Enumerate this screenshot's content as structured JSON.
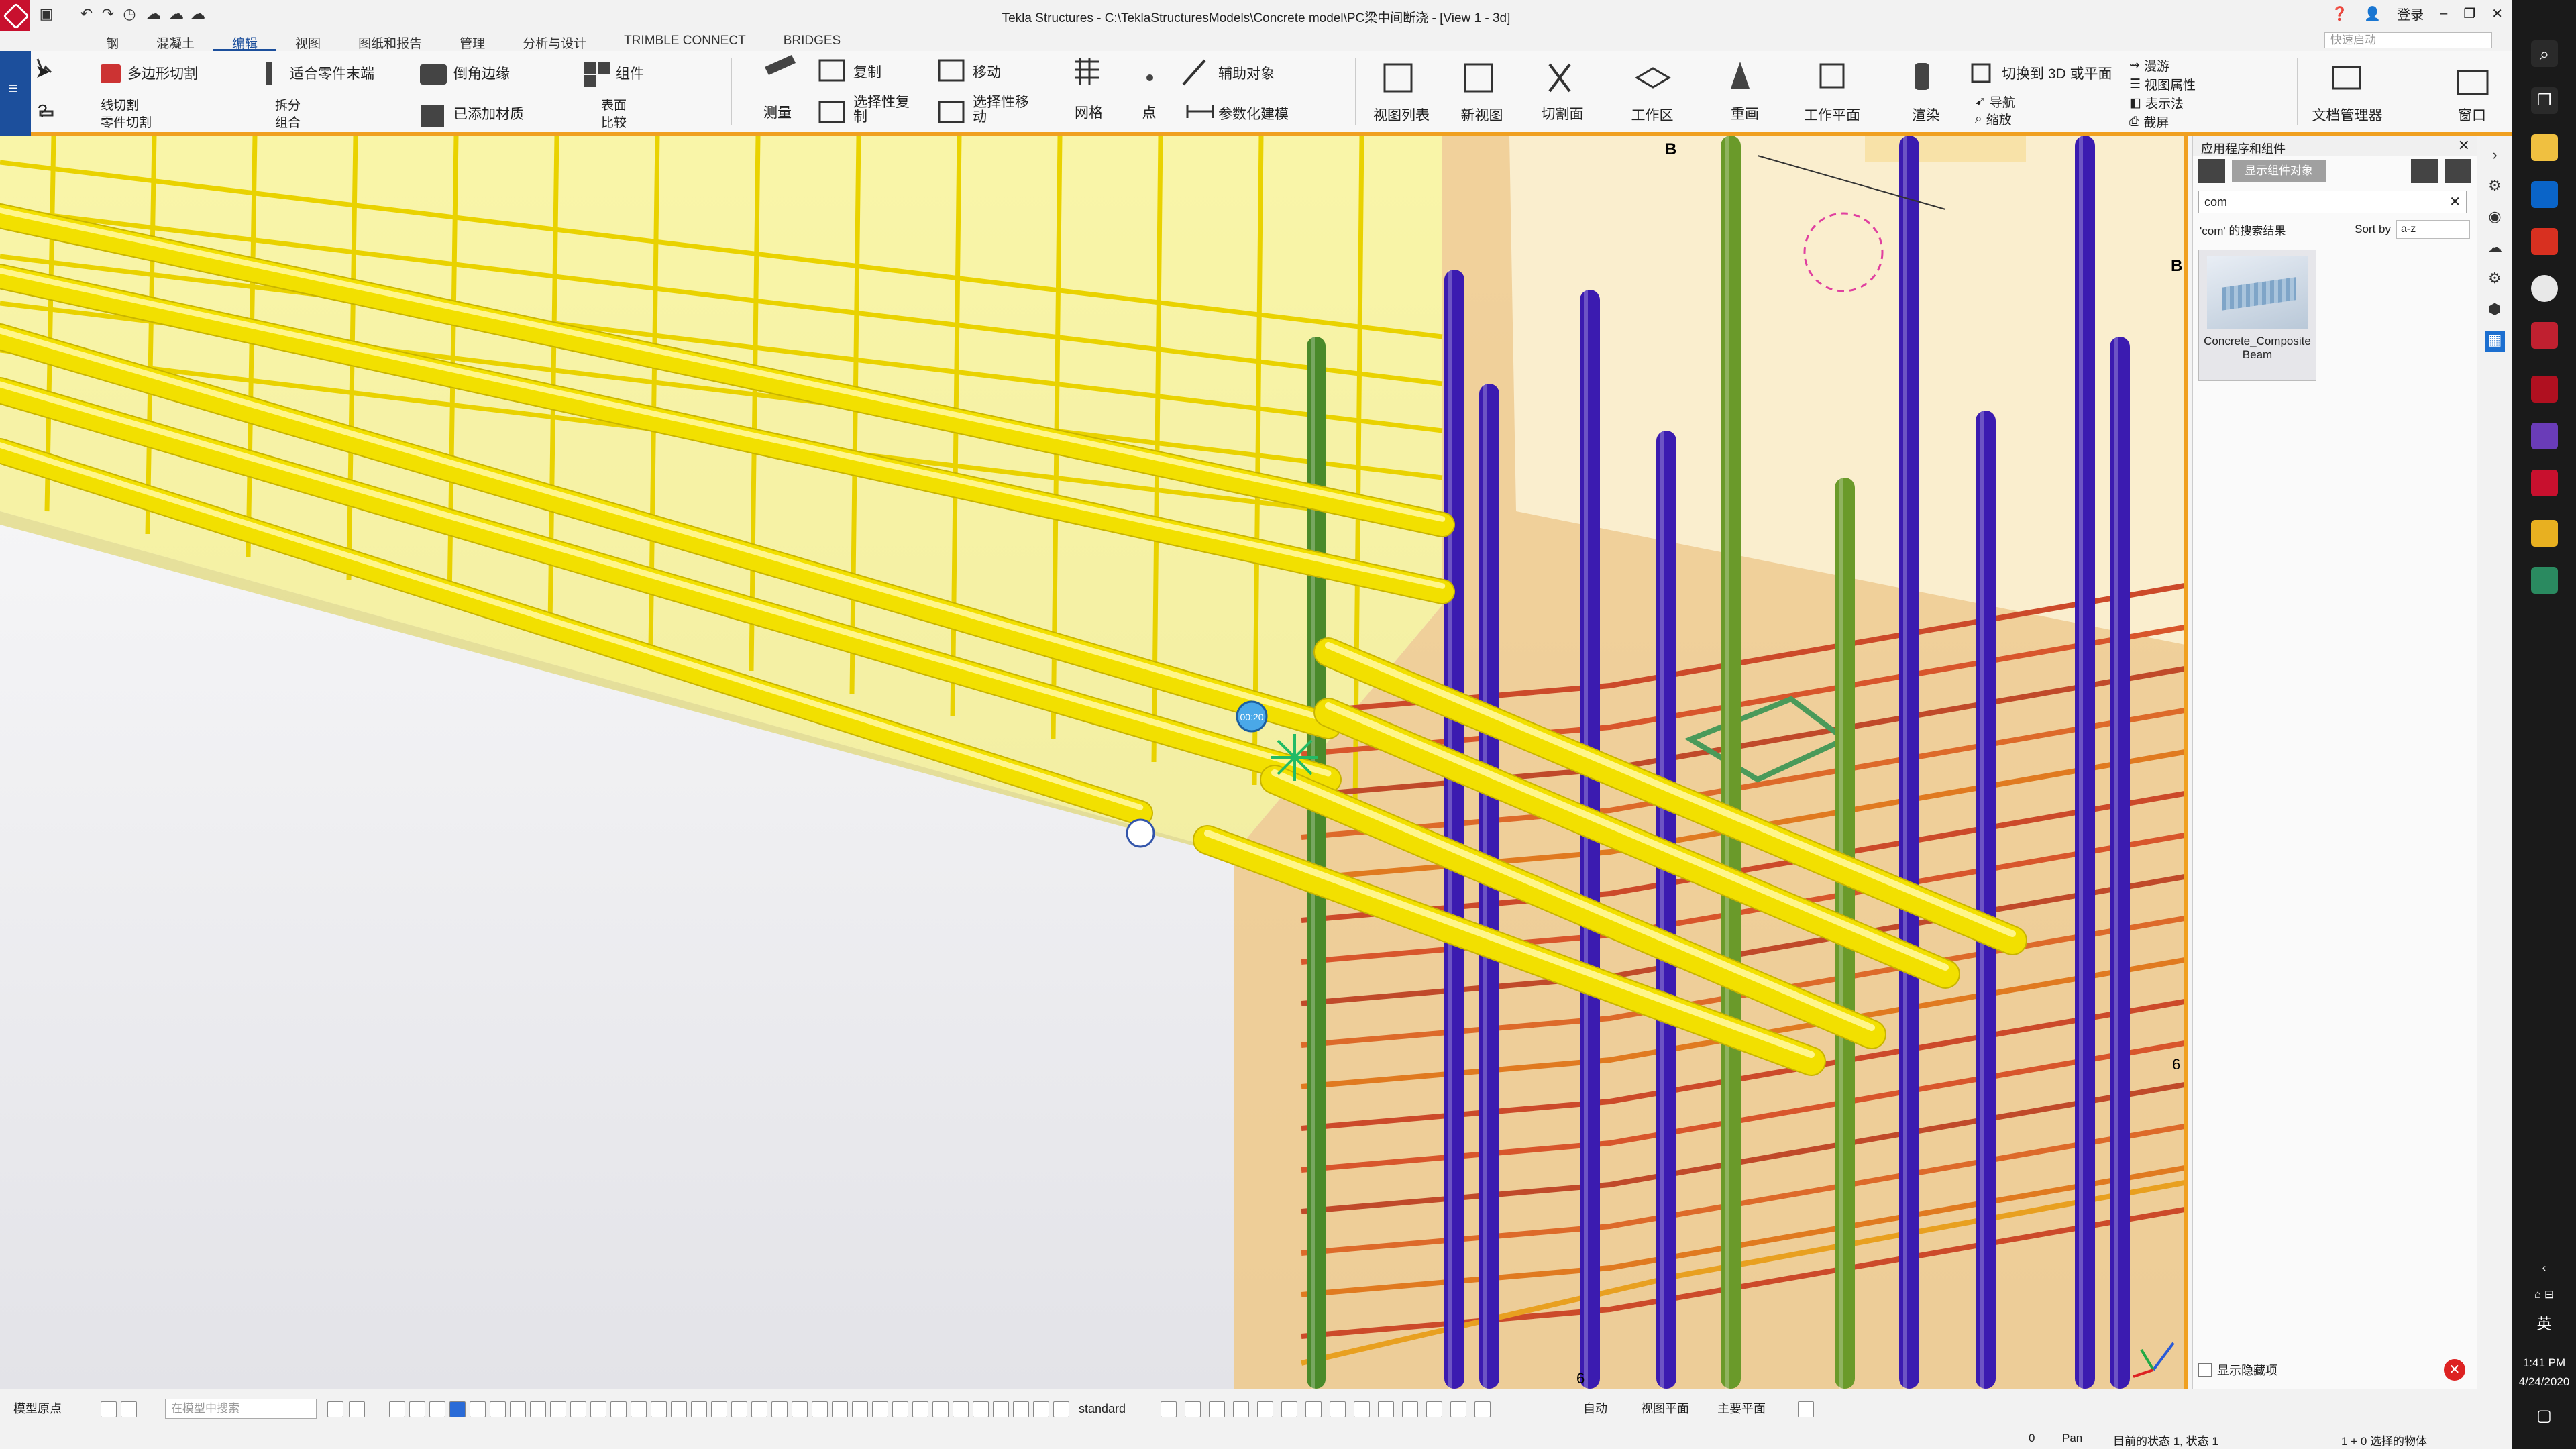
{
  "window": {
    "title": "Tekla Structures - C:\\TeklaStructuresModels\\Concrete model\\PC梁中间断浇 - [View 1 - 3d]",
    "login_label": "登录"
  },
  "tabs": [
    {
      "label": "钢"
    },
    {
      "label": "混凝土"
    },
    {
      "label": "编辑"
    },
    {
      "label": "视图"
    },
    {
      "label": "图纸和报告"
    },
    {
      "label": "管理"
    },
    {
      "label": "分析与设计"
    },
    {
      "label": "TRIMBLE CONNECT"
    },
    {
      "label": "BRIDGES"
    }
  ],
  "quick_launch_placeholder": "快速启动",
  "ribbon": {
    "polygon_cut": "多边形切割",
    "line_cut": "线切割",
    "part_cut": "零件切割",
    "fit_part_end": "适合零件末端",
    "split": "拆分",
    "combine": "组合",
    "chamfer_edges": "倒角边缘",
    "added_material": "已添加材质",
    "component": "组件",
    "surface": "表面",
    "compare": "比较",
    "measure": "测量",
    "copy": "复制",
    "copy_selected": "选择性复制",
    "move": "移动",
    "move_selected": "选择性移动",
    "grid": "网格",
    "point": "点",
    "helper_object": "辅助对象",
    "parametric_modeling": "参数化建模",
    "view_list": "视图列表",
    "new_view": "新视图",
    "clip_plane": "切割面",
    "work_area": "工作区",
    "redraw": "重画",
    "work_plane": "工作平面",
    "render": "渲染",
    "switch_3d": "切换到 3D 或平面",
    "navigate": "导航",
    "zoom": "缩放",
    "roam": "漫游",
    "view_properties": "视图属性",
    "representation": "表示法",
    "screenshot": "截屏",
    "doc_manager": "文档管理器",
    "window": "窗口"
  },
  "viewport": {
    "grid_labels": {
      "b_top": "B",
      "b_right": "B",
      "six_right": "6",
      "six_bottom": "6"
    },
    "cursor_time": "00:20"
  },
  "panel": {
    "title": "应用程序和组件",
    "show_components_btn": "显示组件对象",
    "search_value": "com",
    "results_label": "'com' 的搜索结果",
    "sort_label": "Sort by",
    "sort_value": "a-z",
    "card_name": "Concrete_Composite Beam",
    "show_hidden_label": "显示隐藏项"
  },
  "bottombar": {
    "origin_select": "模型原点",
    "search_placeholder": "在模型中搜索",
    "standard_select": "standard",
    "auto_label": "自动",
    "view_plane_label": "视图平面",
    "main_plane_label": "主要平面"
  },
  "status": {
    "count": "0",
    "mode": "Pan",
    "phase": "目前的状态 1, 状态 1",
    "selection": "1 + 0 选择的物体"
  },
  "taskbar": {
    "time": "1:41 PM",
    "date": "4/24/2020",
    "ime": "英"
  }
}
